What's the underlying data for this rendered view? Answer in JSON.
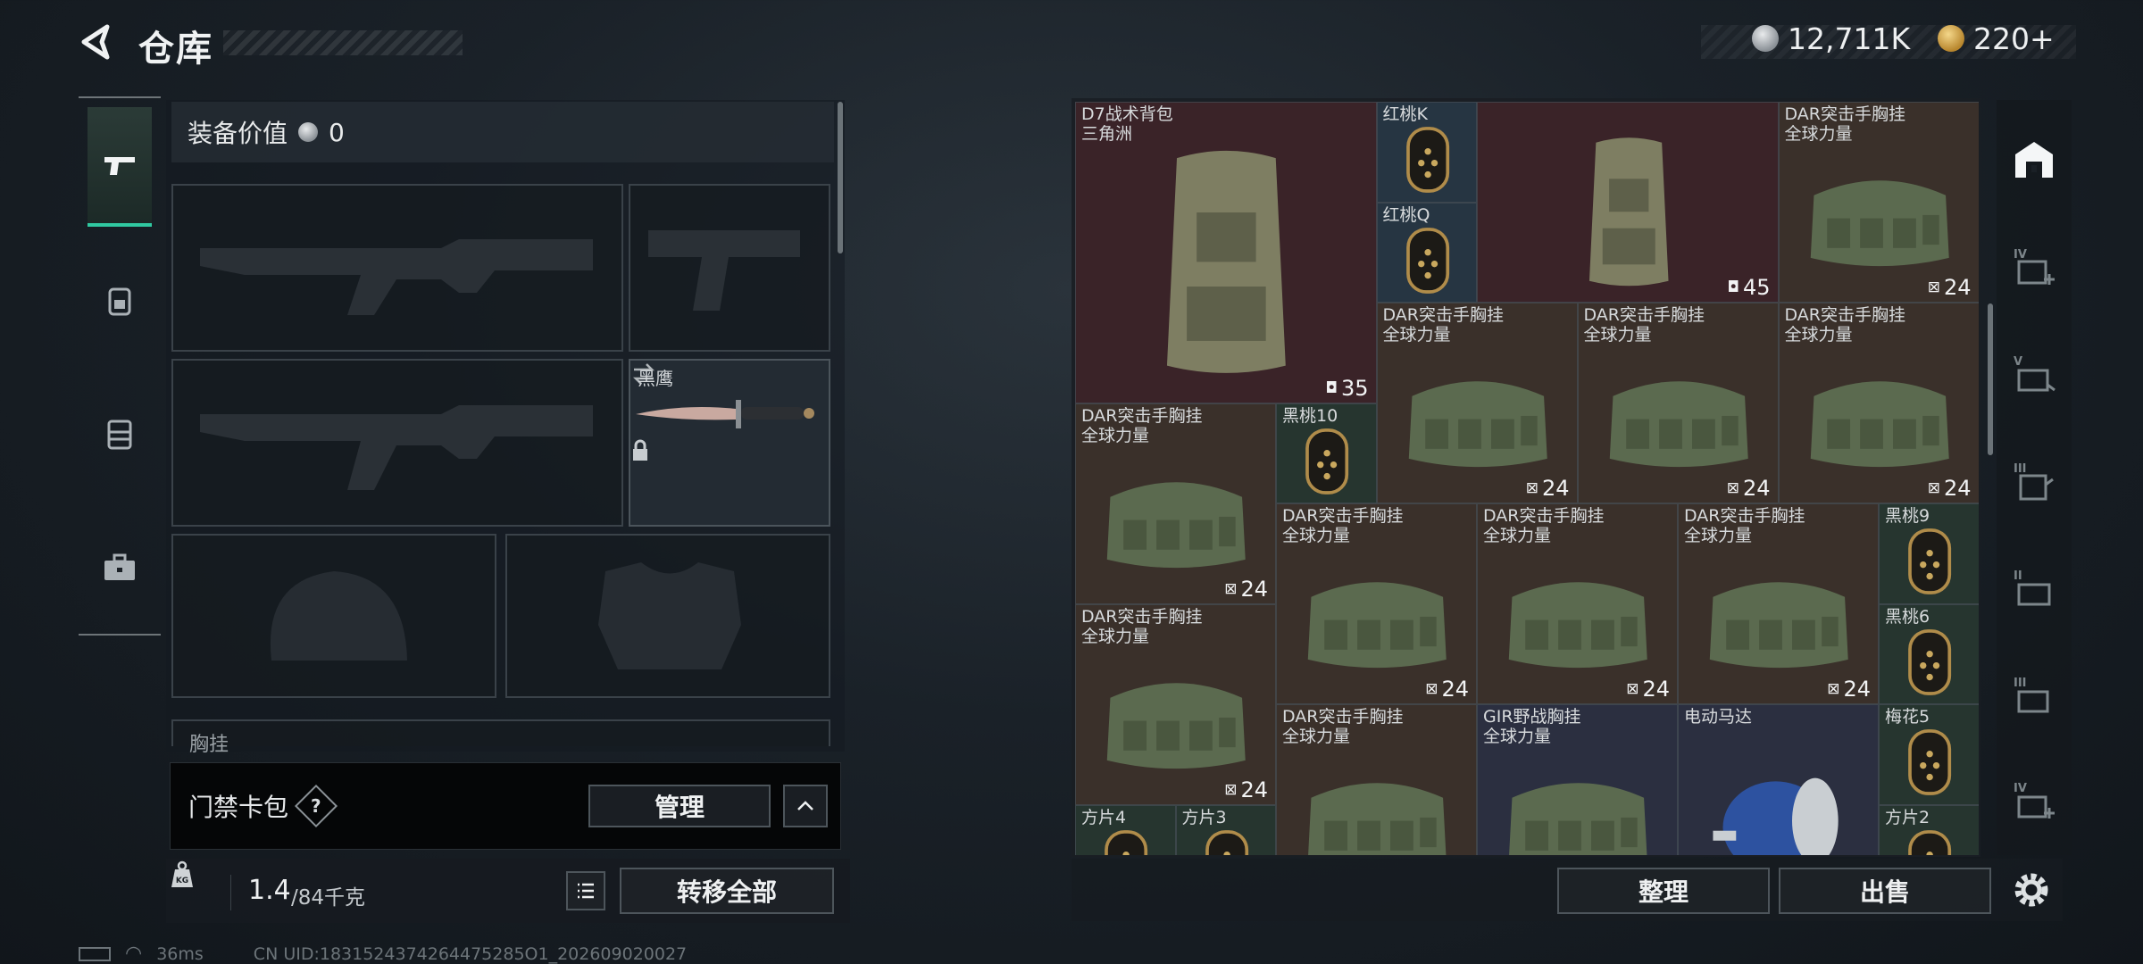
{
  "header": {
    "title": "仓库"
  },
  "currency": {
    "silver": "12,711K",
    "gold": "220+"
  },
  "equipment": {
    "value_label": "装备价值",
    "value": "0",
    "knife_name": "黑鹰",
    "chest_label": "胸挂"
  },
  "card_pack": {
    "label": "门禁卡包",
    "help": "?",
    "manage": "管理"
  },
  "weight": {
    "current": "1.4",
    "max": "/84千克",
    "transfer_all": "转移全部"
  },
  "grid_items": [
    {
      "name": "D7战术背包\n三角洲",
      "count": "35",
      "icon": "backpack"
    },
    {
      "name": "红桃K",
      "count": "",
      "icon": "card"
    },
    {
      "name": "红桃Q",
      "count": "",
      "icon": "card"
    },
    {
      "name": "",
      "count": "45",
      "icon": "backpack"
    },
    {
      "name": "DAR突击手胸挂\n全球力量",
      "count": "24",
      "icon": "vest"
    },
    {
      "name": "DAR突击手胸挂\n全球力量",
      "count": "24",
      "icon": "vest"
    },
    {
      "name": "DAR突击手胸挂\n全球力量",
      "count": "24",
      "icon": "vest"
    },
    {
      "name": "DAR突击手胸挂\n全球力量",
      "count": "24",
      "icon": "vest"
    },
    {
      "name": "DAR突击手胸挂\n全球力量",
      "count": "24",
      "icon": "vest"
    },
    {
      "name": "黑桃10",
      "count": "",
      "icon": "card"
    },
    {
      "name": "DAR突击手胸挂\n全球力量",
      "count": "24",
      "icon": "vest"
    },
    {
      "name": "DAR突击手胸挂\n全球力量",
      "count": "24",
      "icon": "vest"
    },
    {
      "name": "DAR突击手胸挂\n全球力量",
      "count": "24",
      "icon": "vest"
    },
    {
      "name": "黑桃9",
      "count": "",
      "icon": "card"
    },
    {
      "name": "DAR突击手胸挂\n全球力量",
      "count": "24",
      "icon": "vest"
    },
    {
      "name": "黑桃6",
      "count": "",
      "icon": "card"
    },
    {
      "name": "DAR突击手胸挂\n全球力量",
      "count": "",
      "icon": "vest"
    },
    {
      "name": "GIR野战胸挂\n全球力量",
      "count": "",
      "icon": "vest"
    },
    {
      "name": "电动马达",
      "count": "",
      "icon": "motor"
    },
    {
      "name": "梅花5",
      "count": "",
      "icon": "card"
    },
    {
      "name": "方片4",
      "count": "",
      "icon": "card"
    },
    {
      "name": "方片3",
      "count": "",
      "icon": "card"
    },
    {
      "name": "方片2",
      "count": "",
      "icon": "card"
    }
  ],
  "grid_actions": {
    "sort": "整理",
    "sell": "出售"
  },
  "status": {
    "ping": "36ms",
    "uid": "CN UID:1831524374264475285O1_202609020027"
  }
}
